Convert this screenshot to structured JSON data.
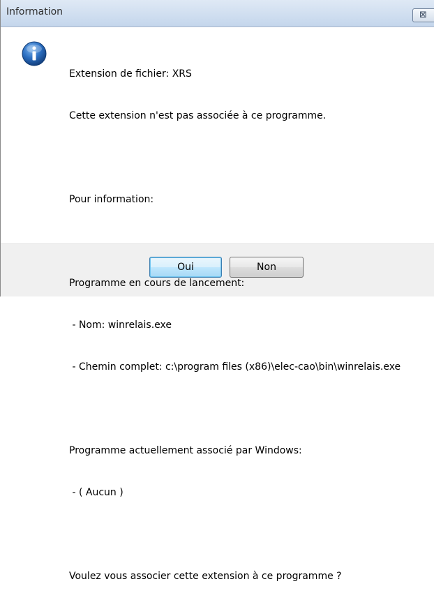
{
  "window": {
    "title": "Information",
    "close_symbol": "⊠",
    "close_icon": "close-icon"
  },
  "icon": {
    "name": "information-icon",
    "glyph": "i",
    "color": "#1f5fae"
  },
  "message": {
    "lines": [
      "Extension de fichier: XRS",
      "Cette extension n'est pas associée à ce programme.",
      "",
      "Pour information:",
      "",
      "Programme en cours de lancement:",
      " - Nom: winrelais.exe",
      " - Chemin complet: c:\\program files (x86)\\elec-cao\\bin\\winrelais.exe",
      "",
      "Programme actuellement associé par Windows:",
      " - ( Aucun )",
      "",
      "Voulez vous associer cette extension à ce programme ?"
    ]
  },
  "buttons": {
    "yes_label": "Oui",
    "no_label": "Non"
  }
}
